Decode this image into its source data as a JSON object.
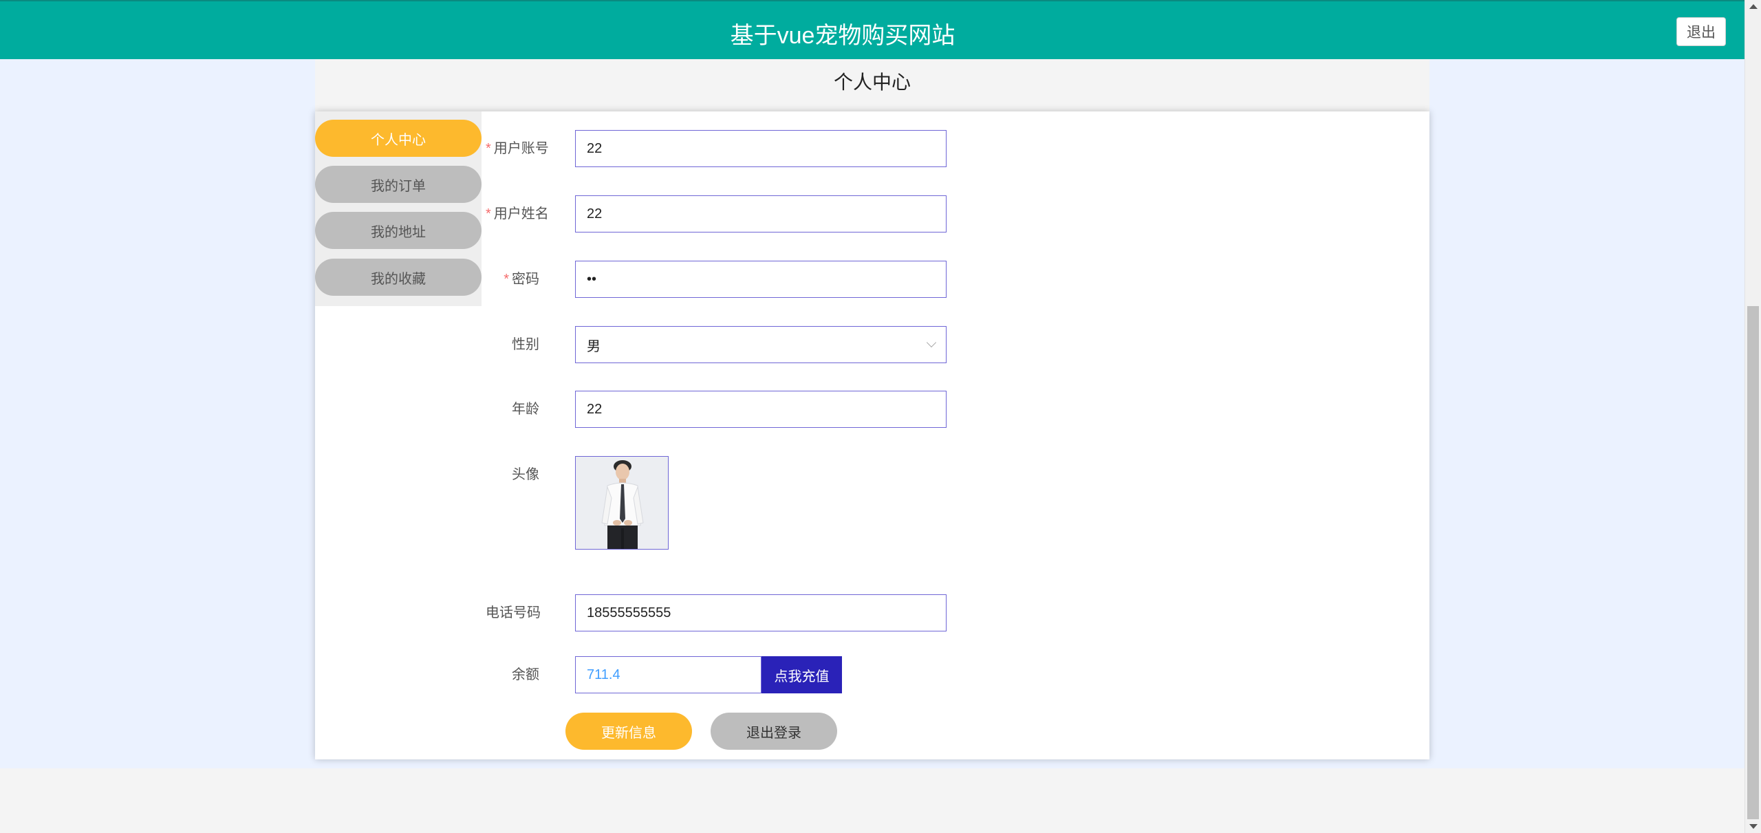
{
  "header": {
    "site_title": "基于vue宠物购买网站",
    "logout_label": "退出"
  },
  "page_title": "个人中心",
  "sidebar": {
    "items": [
      {
        "label": "个人中心",
        "active": true
      },
      {
        "label": "我的订单",
        "active": false
      },
      {
        "label": "我的地址",
        "active": false
      },
      {
        "label": "我的收藏",
        "active": false
      }
    ]
  },
  "form": {
    "account": {
      "label": "用户账号",
      "value": "22",
      "required": true
    },
    "name": {
      "label": "用户姓名",
      "value": "22",
      "required": true
    },
    "password": {
      "label": "密码",
      "value": "••",
      "required": true
    },
    "gender": {
      "label": "性别",
      "value": "男"
    },
    "age": {
      "label": "年龄",
      "value": "22"
    },
    "avatar": {
      "label": "头像",
      "icon": "avatar-photo"
    },
    "phone": {
      "label": "电话号码",
      "value": "18555555555"
    },
    "balance": {
      "label": "余额",
      "value": "711.4",
      "recharge_label": "点我充值"
    }
  },
  "actions": {
    "update_label": "更新信息",
    "logout_label": "退出登录"
  },
  "colors": {
    "header": "#00ac9e",
    "accent": "#fdb92d",
    "recharge": "#2a22b8",
    "balance_text": "#409eff",
    "page_bg": "#ebf2ff"
  }
}
